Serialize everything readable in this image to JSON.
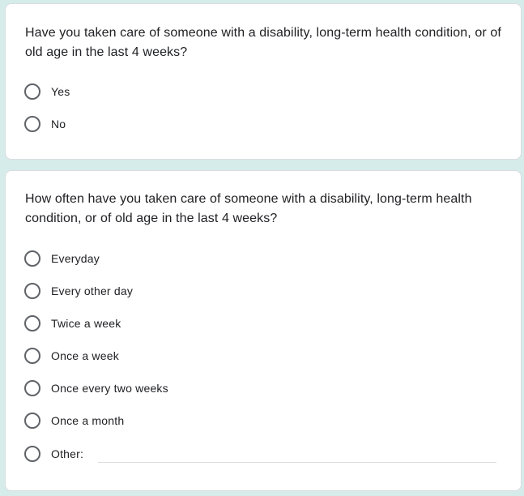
{
  "question1": {
    "text": "Have you taken care of someone with a disability, long-term health condition, or of old age in the last 4 weeks?",
    "options": [
      "Yes",
      "No"
    ]
  },
  "question2": {
    "text": "How often have you taken care of someone with a disability, long-term health condition, or of old age in the last 4 weeks?",
    "options": [
      "Everyday",
      "Every other day",
      "Twice a week",
      "Once a week",
      "Once every two weeks",
      "Once a month",
      "Other:"
    ],
    "other_value": ""
  },
  "colors": {
    "page_background": "#d6ecea",
    "card_background": "#ffffff",
    "radio_border": "#5f6368",
    "text": "#202124"
  },
  "icons": {
    "radio": "radio-unchecked-icon"
  }
}
